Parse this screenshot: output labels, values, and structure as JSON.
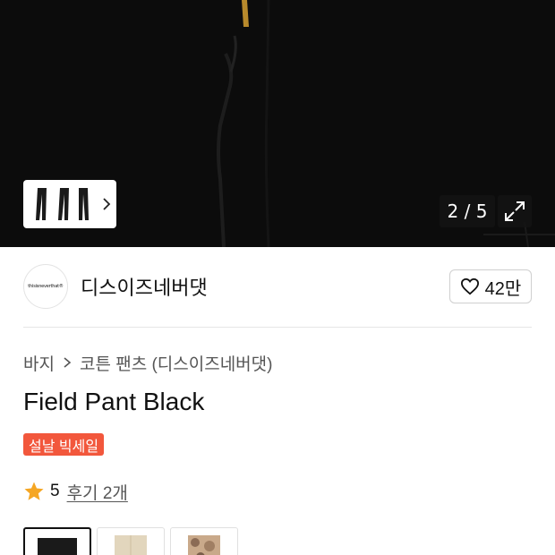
{
  "gallery": {
    "counter": "2 / 5",
    "thumb_icons": [
      "pants-thumbnail-icon",
      "chevron-right-icon"
    ],
    "expand_icon": "expand-icon"
  },
  "brand": {
    "logo_text": "thisisneverthat®",
    "name": "디스이즈네버댓",
    "like_count": "42만"
  },
  "breadcrumb": {
    "items": [
      "바지",
      "코튼 팬츠 (디스이즈네버댓)"
    ]
  },
  "product": {
    "title": "Field Pant Black",
    "badge": "설날 빅세일",
    "rating_score": "5",
    "reviews_label": "후기 2개",
    "star_color": "#f5a623",
    "badge_color": "#f2573c"
  },
  "swatches": {
    "colors": [
      "black",
      "beige",
      "camo"
    ],
    "selected": "black"
  }
}
